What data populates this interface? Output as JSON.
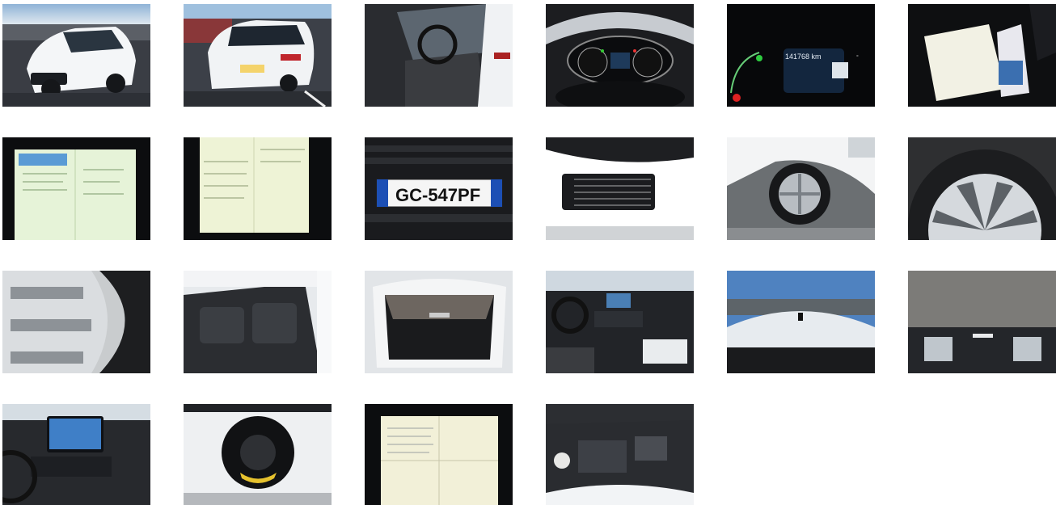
{
  "gallery": {
    "photos": [
      {
        "subject": "front three-quarter view of white car"
      },
      {
        "subject": "rear three-quarter view of white car"
      },
      {
        "subject": "driver door open, front seats"
      },
      {
        "subject": "instrument cluster"
      },
      {
        "subject": "instrument cluster close-up with odometer",
        "odometer": "141768 km"
      },
      {
        "subject": "service booklet and documents on seat"
      },
      {
        "subject": "registration document page 1"
      },
      {
        "subject": "registration document page 2"
      },
      {
        "subject": "front license plate",
        "plate": "GC-547PF"
      },
      {
        "subject": "tire pressure label"
      },
      {
        "subject": "front wheel side view"
      },
      {
        "subject": "wheel and tire close-up"
      },
      {
        "subject": "tire sidewall close-up"
      },
      {
        "subject": "rear seats"
      },
      {
        "subject": "open trunk with cargo cover"
      },
      {
        "subject": "dashboard and center console"
      },
      {
        "subject": "roof view"
      },
      {
        "subject": "headliner interior view"
      },
      {
        "subject": "infotainment screen"
      },
      {
        "subject": "spare wheel in trunk well"
      },
      {
        "subject": "registration document folded"
      },
      {
        "subject": "engine bay"
      }
    ]
  }
}
